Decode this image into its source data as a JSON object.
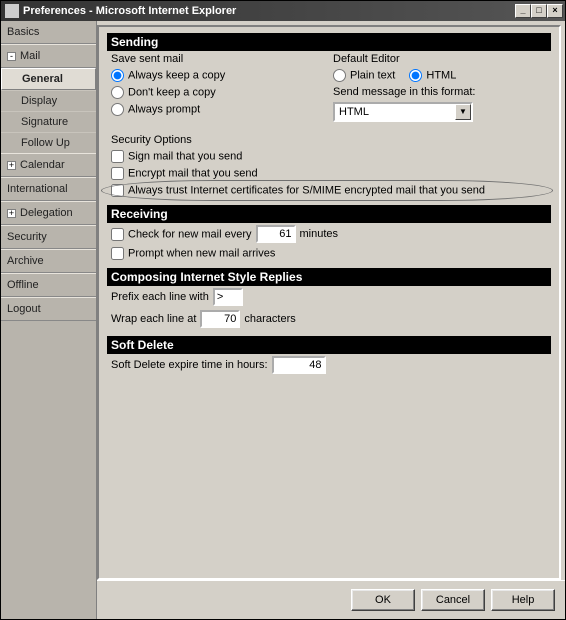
{
  "window": {
    "title": "Preferences - Microsoft Internet Explorer",
    "min_label": "_",
    "max_label": "□",
    "close_label": "×"
  },
  "sidebar": {
    "basics": "Basics",
    "mail": "Mail",
    "mail_sub": {
      "general": "General",
      "display": "Display",
      "signature": "Signature",
      "follow_up": "Follow Up"
    },
    "calendar": "Calendar",
    "international": "International",
    "delegation": "Delegation",
    "security": "Security",
    "archive": "Archive",
    "offline": "Offline",
    "logout": "Logout",
    "twisty_minus": "-",
    "twisty_plus": "+"
  },
  "sending": {
    "header": "Sending",
    "save_sent_label": "Save sent mail",
    "opt_keep": "Always keep a copy",
    "opt_dont": "Don't keep a copy",
    "opt_prompt": "Always prompt",
    "default_editor_label": "Default Editor",
    "opt_plain": "Plain text",
    "opt_html": "HTML",
    "send_fmt_label": "Send message in this format:",
    "send_fmt_value": "HTML"
  },
  "security": {
    "header": "Security Options",
    "sign": "Sign mail that you send",
    "encrypt": "Encrypt mail that you send",
    "trust": "Always trust Internet certificates for S/MIME encrypted mail that you send"
  },
  "receiving": {
    "header": "Receiving",
    "check_prefix": "Check for new mail every",
    "check_value": "61",
    "check_suffix": "minutes",
    "prompt": "Prompt when new mail arrives"
  },
  "composing": {
    "header": "Composing Internet Style Replies",
    "prefix_label": "Prefix each line with",
    "prefix_value": ">",
    "wrap_label": "Wrap each line at",
    "wrap_value": "70",
    "wrap_suffix": "characters"
  },
  "softdelete": {
    "header": "Soft Delete",
    "label": "Soft Delete expire time in hours:",
    "value": "48"
  },
  "buttons": {
    "ok": "OK",
    "cancel": "Cancel",
    "help": "Help"
  }
}
